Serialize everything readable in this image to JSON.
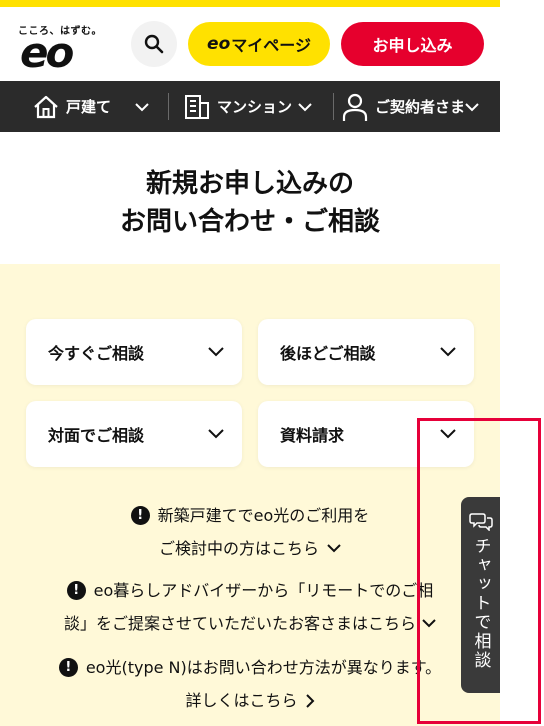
{
  "header": {
    "logo_tagline": "こころ、はずむ。",
    "logo_text": "eo",
    "search_icon": "search-icon",
    "mypage_prefix": "eo",
    "mypage_label": "マイページ",
    "apply_label": "お申し込み"
  },
  "nav": [
    {
      "label": "戸建て",
      "icon": "house-icon"
    },
    {
      "label": "マンション",
      "icon": "building-icon"
    },
    {
      "label": "ご契約者さま",
      "icon": "person-icon"
    }
  ],
  "heading": {
    "line1": "新規お申し込みの",
    "line2": "お問い合わせ・ご相談"
  },
  "cards": [
    {
      "label": "今すぐご相談"
    },
    {
      "label": "後ほどご相談"
    },
    {
      "label": "対面でご相談"
    },
    {
      "label": "資料請求"
    }
  ],
  "notices": [
    {
      "line1": "新築戸建てでeo光のご利用を",
      "line2": "ご検討中の方はこちら"
    },
    {
      "line1": "eo暮らしアドバイザーから「リモートでのご相",
      "line2": "談」をご提案させていただいたお客さまはこちら"
    },
    {
      "line1": "eo光(type N)はお問い合わせ方法が異なります。",
      "line2": "詳しくはこちら"
    }
  ],
  "chat": {
    "label": "チャットで相談",
    "icon": "chat-bubbles-icon"
  },
  "colors": {
    "yellow": "#ffe100",
    "red": "#e6002d",
    "navbar": "#2b2b2b",
    "section_bg": "#fff9d8",
    "highlight": "#e60039"
  }
}
